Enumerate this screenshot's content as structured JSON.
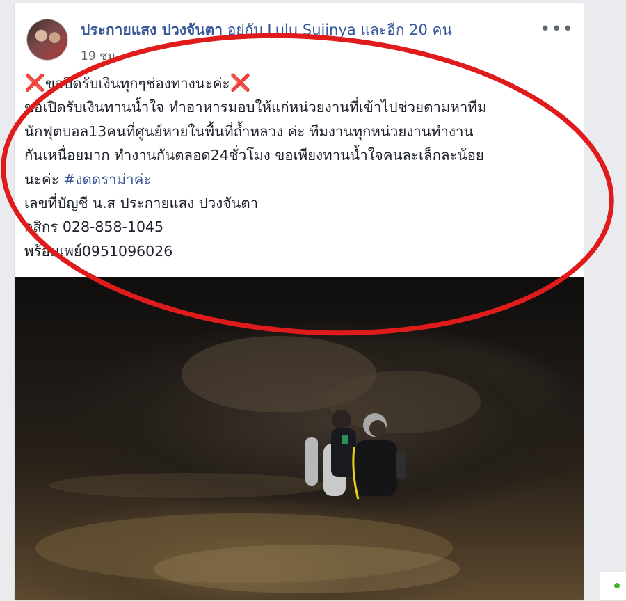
{
  "post": {
    "author_name": "ประกายแสง ปวงจันตา",
    "author_rest": " อยู่กับ Lulu Sujinya และอีก 20 คน",
    "timestamp": "19 ชม.",
    "more_icon": "•••",
    "body_lines": [
      [
        "ขอปิดรับเงินทุกๆช่องทางนะค่ะ"
      ],
      [
        "ขอเปิดรับเงินทานน้ำใจ ทำอาหารมอบให้แก่หน่วยงานที่เข้าไปช่วยตามหาทีม"
      ],
      [
        "นักฟุตบอล13คนที่ศูนย์หายในพื้นที่ถ้ำหลวง ค่ะ ทีมงานทุกหน่วยงานทำงาน"
      ],
      [
        "กันเหนื่อยมาก ทำงานกันตลอด24ชั่วโมง ขอเพียงทานน้ำใจคนละเล็กละน้อย"
      ],
      [
        "นะค่ะ ",
        "#งดดราม่าค่ะ"
      ],
      [
        "เลขที่บัญชี น.ส ประกายแสง ปวงจันตา"
      ],
      [
        "กสิกร 028-858-1045"
      ],
      [
        "พร้อมเพย์0951096026"
      ]
    ],
    "x_mark": "❌"
  },
  "colors": {
    "link": "#365899",
    "annotation_ellipse": "#e01b1b",
    "online_dot": "#42b72a"
  },
  "icons": {
    "avatar": "profile-photo",
    "more": "more-options-icon",
    "x_mark": "red-cross-mark-icon"
  }
}
